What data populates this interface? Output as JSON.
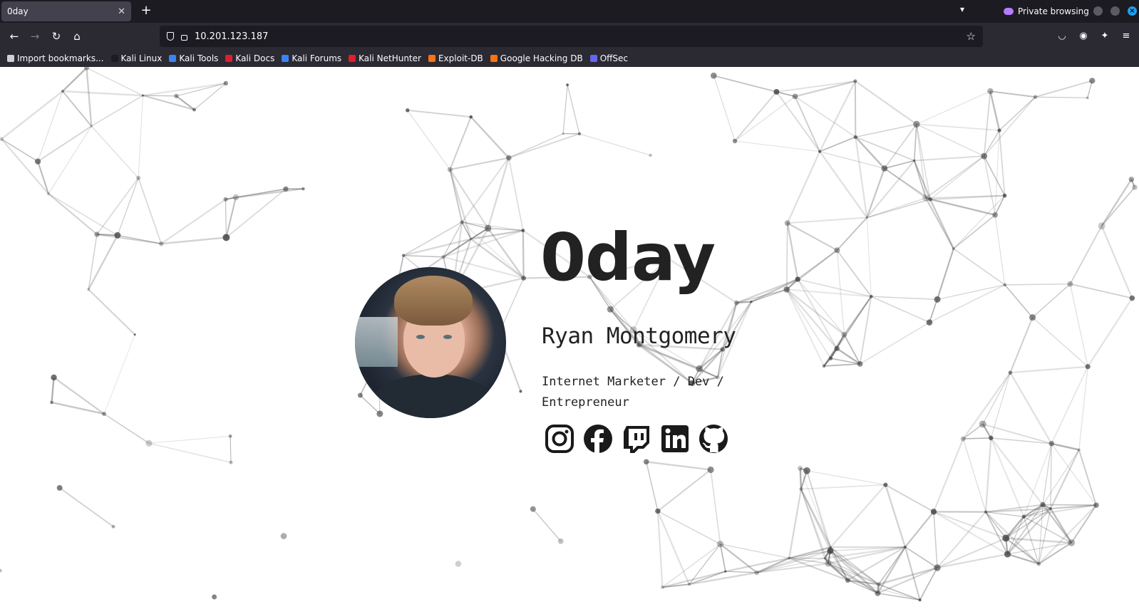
{
  "browser": {
    "tab_title": "0day",
    "tab_close": "✕",
    "new_tab": "+",
    "private_label": "Private browsing",
    "url": "10.201.123.187"
  },
  "bookmarks": [
    {
      "label": "Import bookmarks...",
      "icon": "import-icon",
      "color": "#cfcfd8"
    },
    {
      "label": "Kali Linux",
      "icon": "kali-dragon-icon",
      "color": "#1c1b22"
    },
    {
      "label": "Kali Tools",
      "icon": "kali-tools-icon",
      "color": "#3b82f6"
    },
    {
      "label": "Kali Docs",
      "icon": "kali-docs-icon",
      "color": "#e11d2e"
    },
    {
      "label": "Kali Forums",
      "icon": "kali-forums-icon",
      "color": "#3b82f6"
    },
    {
      "label": "Kali NetHunter",
      "icon": "nethunter-icon",
      "color": "#e11d2e"
    },
    {
      "label": "Exploit-DB",
      "icon": "exploit-db-icon",
      "color": "#f97316"
    },
    {
      "label": "Google Hacking DB",
      "icon": "ghdb-icon",
      "color": "#f97316"
    },
    {
      "label": "OffSec",
      "icon": "offsec-icon",
      "color": "#6366f1"
    }
  ],
  "profile": {
    "title": "0day",
    "name": "Ryan Montgomery",
    "tagline": "Internet Marketer / Dev / Entrepreneur"
  },
  "socials": [
    {
      "icon": "instagram-icon"
    },
    {
      "icon": "facebook-icon"
    },
    {
      "icon": "twitch-icon"
    },
    {
      "icon": "linkedin-icon"
    },
    {
      "icon": "github-icon"
    }
  ]
}
